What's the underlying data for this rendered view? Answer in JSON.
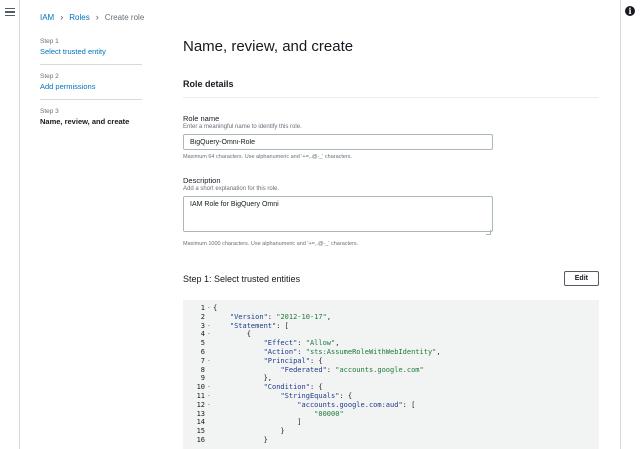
{
  "breadcrumb": [
    {
      "label": "IAM",
      "link": true
    },
    {
      "label": "Roles",
      "link": true
    },
    {
      "label": "Create role",
      "link": false
    }
  ],
  "steps": [
    {
      "num": "Step 1",
      "label": "Select trusted entity",
      "active": false
    },
    {
      "num": "Step 2",
      "label": "Add permissions",
      "active": false
    },
    {
      "num": "Step 3",
      "label": "Name, review, and create",
      "active": true
    }
  ],
  "page_title": "Name, review, and create",
  "role_details": {
    "title": "Role details",
    "role_name": {
      "label": "Role name",
      "desc": "Enter a meaningful name to identify this role.",
      "value": "BigQuery-Omni-Role",
      "help": "Maximum 64 characters. Use alphanumeric and '+=,.@-_' characters."
    },
    "description": {
      "label": "Description",
      "desc": "Add a short explanation for this role.",
      "value": "IAM Role for BigQuery Omni",
      "help": "Maximum 1000 characters. Use alphanumeric and '+=,.@-_' characters."
    }
  },
  "trusted_entities": {
    "title": "Step 1: Select trusted entities",
    "edit_label": "Edit"
  },
  "code_lines": [
    {
      "n": "1",
      "fold": "-",
      "tokens": [
        [
          "p",
          "{"
        ]
      ]
    },
    {
      "n": "2",
      "fold": "",
      "tokens": [
        [
          "p",
          "    "
        ],
        [
          "k",
          "\"Version\""
        ],
        [
          "p",
          ": "
        ],
        [
          "s",
          "\"2012-10-17\""
        ],
        [
          "p",
          ","
        ]
      ]
    },
    {
      "n": "3",
      "fold": "-",
      "tokens": [
        [
          "p",
          "    "
        ],
        [
          "k",
          "\"Statement\""
        ],
        [
          "p",
          ": ["
        ]
      ]
    },
    {
      "n": "4",
      "fold": "-",
      "tokens": [
        [
          "p",
          "        {"
        ]
      ]
    },
    {
      "n": "5",
      "fold": "",
      "tokens": [
        [
          "p",
          "            "
        ],
        [
          "k",
          "\"Effect\""
        ],
        [
          "p",
          ": "
        ],
        [
          "s",
          "\"Allow\""
        ],
        [
          "p",
          ","
        ]
      ]
    },
    {
      "n": "6",
      "fold": "",
      "tokens": [
        [
          "p",
          "            "
        ],
        [
          "k",
          "\"Action\""
        ],
        [
          "p",
          ": "
        ],
        [
          "s",
          "\"sts:AssumeRoleWithWebIdentity\""
        ],
        [
          "p",
          ","
        ]
      ]
    },
    {
      "n": "7",
      "fold": "-",
      "tokens": [
        [
          "p",
          "            "
        ],
        [
          "k",
          "\"Principal\""
        ],
        [
          "p",
          ": {"
        ]
      ]
    },
    {
      "n": "8",
      "fold": "",
      "tokens": [
        [
          "p",
          "                "
        ],
        [
          "k",
          "\"Federated\""
        ],
        [
          "p",
          ": "
        ],
        [
          "s",
          "\"accounts.google.com\""
        ]
      ]
    },
    {
      "n": "9",
      "fold": "",
      "tokens": [
        [
          "p",
          "            },"
        ]
      ]
    },
    {
      "n": "10",
      "fold": "-",
      "tokens": [
        [
          "p",
          "            "
        ],
        [
          "k",
          "\"Condition\""
        ],
        [
          "p",
          ": {"
        ]
      ]
    },
    {
      "n": "11",
      "fold": "-",
      "tokens": [
        [
          "p",
          "                "
        ],
        [
          "k",
          "\"StringEquals\""
        ],
        [
          "p",
          ": {"
        ]
      ]
    },
    {
      "n": "12",
      "fold": "-",
      "tokens": [
        [
          "p",
          "                    "
        ],
        [
          "k",
          "\"accounts.google.com:aud\""
        ],
        [
          "p",
          ": ["
        ]
      ]
    },
    {
      "n": "13",
      "fold": "",
      "tokens": [
        [
          "p",
          "                        "
        ],
        [
          "s",
          "\"00000\""
        ]
      ]
    },
    {
      "n": "14",
      "fold": "",
      "tokens": [
        [
          "p",
          "                    ]"
        ]
      ]
    },
    {
      "n": "15",
      "fold": "",
      "tokens": [
        [
          "p",
          "                }"
        ]
      ]
    },
    {
      "n": "16",
      "fold": "",
      "tokens": [
        [
          "p",
          "            }"
        ]
      ]
    }
  ],
  "icons": {
    "menu": "hamburger-menu-icon",
    "info": "info-icon"
  },
  "colors": {
    "link": "#0073bb",
    "code_bg": "#f2f3f3",
    "json_key": "#1d3b8a",
    "json_string": "#1d7a3a"
  }
}
